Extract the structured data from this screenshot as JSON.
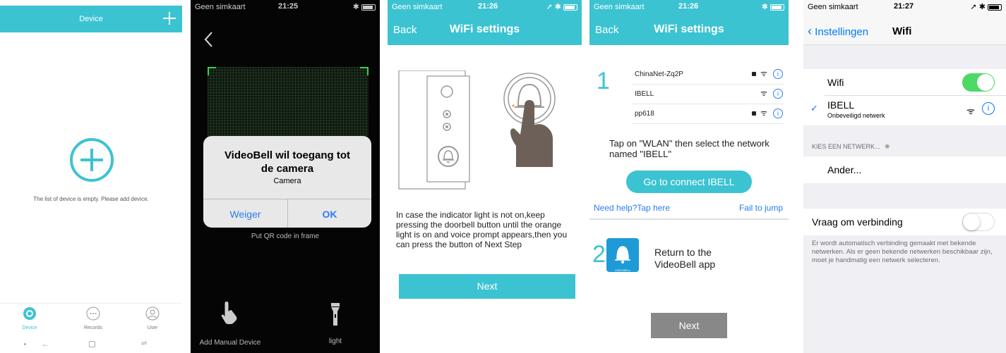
{
  "panel1": {
    "header_title": "Device",
    "add_icon": "plus-icon",
    "empty_text": "The list of device is empty. Please add device.",
    "tabs": [
      {
        "label": "Device",
        "icon": "device-icon"
      },
      {
        "label": "Records",
        "icon": "chat-icon"
      },
      {
        "label": "User",
        "icon": "user-icon"
      }
    ],
    "colors": {
      "accent": "#3cc3d2"
    }
  },
  "panel2": {
    "status": {
      "carrier": "Geen simkaart",
      "time": "21:25"
    },
    "dialog": {
      "title": "VideoBell wil toegang tot de camera",
      "subtitle": "Camera",
      "deny": "Weiger",
      "ok": "OK"
    },
    "qr_hint": "Put QR code in frame",
    "manual_label": "Add Manual Device",
    "light_label": "light"
  },
  "panel3": {
    "status": {
      "carrier": "Geen simkaart",
      "time": "21:26"
    },
    "back": "Back",
    "title": "WiFi settings",
    "instructions": "In case the indicator light is not on,keep pressing the doorbell button until the orange light is on and voice prompt appears,then you can press the button of Next Step",
    "next": "Next"
  },
  "panel4": {
    "status": {
      "carrier": "Geen simkaart",
      "time": "21:26"
    },
    "back": "Back",
    "title": "WiFi settings",
    "step1": "1",
    "step2": "2",
    "networks": [
      {
        "name": "ChinaNet-Zq2P",
        "locked": true
      },
      {
        "name": "IBELL",
        "locked": false
      },
      {
        "name": "pp618",
        "locked": true
      }
    ],
    "tap_text": "Tap on \"WLAN\" then select the network named \"IBELL\"",
    "connect": "Go to connect IBELL",
    "help": "Need help?Tap here",
    "fail": "Fail to jump",
    "return_text": "Return to the VideoBell app",
    "logo_text": "VIDEOBELL",
    "next": "Next"
  },
  "panel5": {
    "status": {
      "carrier": "Geen simkaart",
      "time": "21:27"
    },
    "back": "Instellingen",
    "title": "Wifi",
    "wifi_label": "Wifi",
    "wifi_on": true,
    "network_name": "IBELL",
    "network_sub": "Onbeveiligd netwerk",
    "section_header": "KIES EEN NETWERK...",
    "other": "Ander...",
    "ask_label": "Vraag om verbinding",
    "ask_on": false,
    "footer": "Er wordt automatisch verbinding gemaakt met bekende netwerken. Als er geen bekende netwerken beschikbaar zijn, moet je handmatig een netwerk selecteren.",
    "colors": {
      "switch_on": "#4cd964",
      "ios_blue": "#007aff"
    }
  }
}
